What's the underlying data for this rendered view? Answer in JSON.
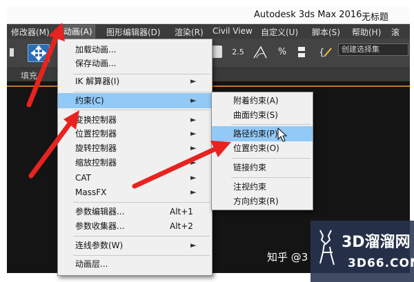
{
  "window": {
    "app_title": "Autodesk 3ds Max 2016",
    "doc_title": "无标题"
  },
  "menubar": [
    "修改器(M)",
    "动画(A)",
    "图形编辑器(D)",
    "渲染(R)",
    "Civil View",
    "自定义(U)",
    "脚本(S)",
    "帮助(H)",
    "滚"
  ],
  "toolbar": {
    "snap_angle": "2.5",
    "percent": "%",
    "selection_set_placeholder": "创建选择集"
  },
  "subbar": {
    "label": "填充"
  },
  "animation_menu": {
    "items": [
      {
        "label": "加载动画..."
      },
      {
        "label": "保存动画..."
      },
      {
        "label": "IK 解算器(I)",
        "submenu": true
      },
      {
        "label": "约束(C)",
        "submenu": true,
        "highlighted": true
      },
      {
        "label": "变换控制器",
        "submenu": true
      },
      {
        "label": "位置控制器",
        "submenu": true
      },
      {
        "label": "旋转控制器",
        "submenu": true
      },
      {
        "label": "缩放控制器",
        "submenu": true
      },
      {
        "label": "CAT",
        "submenu": true
      },
      {
        "label": "MassFX",
        "submenu": true
      },
      {
        "label": "参数编辑器...",
        "shortcut": "Alt+1"
      },
      {
        "label": "参数收集器...",
        "shortcut": "Alt+2"
      },
      {
        "label": "连线参数(W)",
        "submenu": true
      },
      {
        "label": "动画层..."
      }
    ]
  },
  "constraints_menu": {
    "items": [
      {
        "label": "附着约束(A)"
      },
      {
        "label": "曲面约束(S)"
      },
      {
        "label": "路径约束(P)",
        "highlighted": true
      },
      {
        "label": "位置约束(O)"
      },
      {
        "label": "链接约束"
      },
      {
        "label": "注视约束"
      },
      {
        "label": "方向约束(R)"
      }
    ]
  },
  "watermark": {
    "zhihu": "知乎 @3",
    "site_title": "3D溜溜网",
    "site_url": "3D66.COM"
  },
  "colors": {
    "highlight": "#91c9f7",
    "arrow": "#e8231f",
    "menubar": "#3c3c3c"
  }
}
